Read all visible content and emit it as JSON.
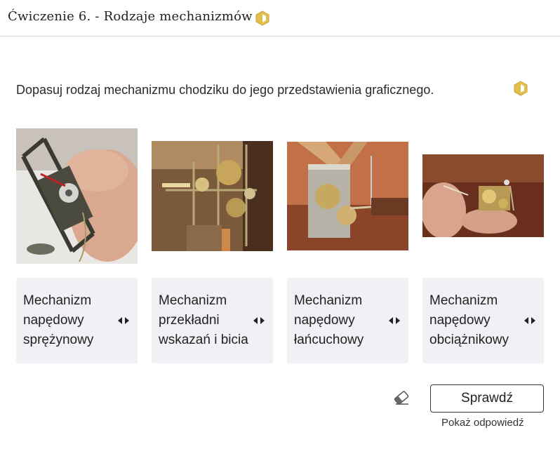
{
  "header": {
    "title": "Ćwiczenie 6. - Rodzaje mechanizmów",
    "icon": "hexagon-badge-icon"
  },
  "instruction": "Dopasuj rodzaj mechanizmu chodziku do jego przedstawienia graficznego.",
  "images": [
    {
      "name": "photo-spring-mechanism"
    },
    {
      "name": "photo-gear-mechanism"
    },
    {
      "name": "photo-chain-mechanism"
    },
    {
      "name": "photo-weight-mechanism"
    }
  ],
  "cards": [
    {
      "label": "Mechanizm napędowy sprężynowy"
    },
    {
      "label": "Mechanizm przekładni wskazań i bicia"
    },
    {
      "label": "Mechanizm napędowy łańcuchowy"
    },
    {
      "label": "Mechanizm napędowy obciążnikowy"
    }
  ],
  "actions": {
    "check_label": "Sprawdź",
    "show_answer_label": "Pokaż odpowiedź",
    "reset_icon": "eraser-icon"
  },
  "colors": {
    "accent": "#d9b43a",
    "card_bg": "#f0f1f5"
  }
}
